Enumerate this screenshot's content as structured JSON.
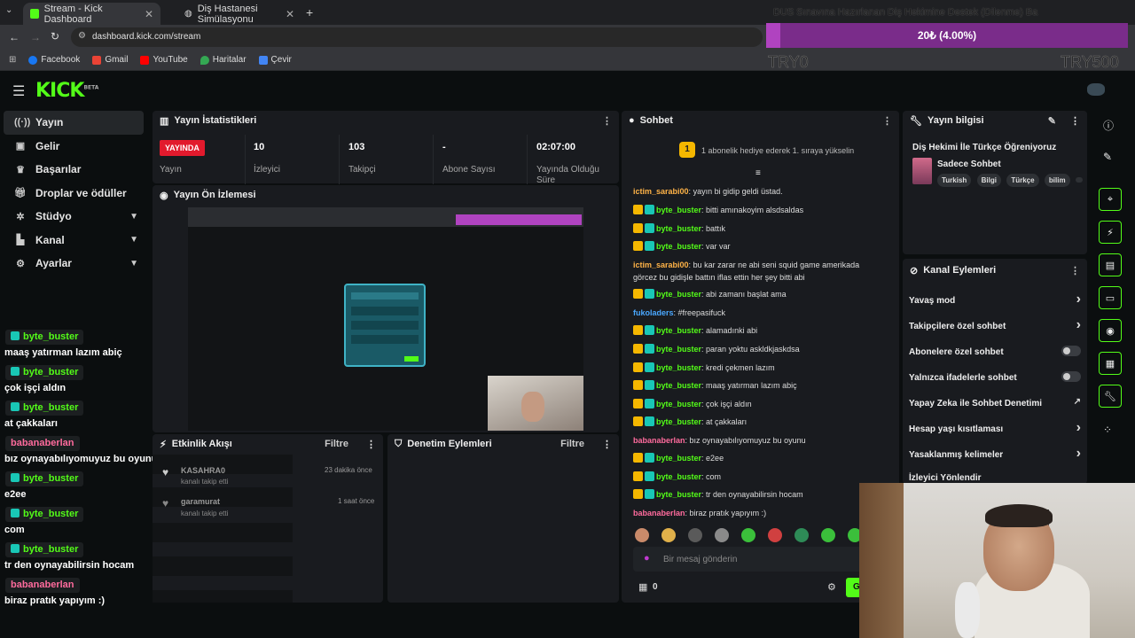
{
  "browser": {
    "tabs": [
      {
        "title": "Stream - Kick Dashboard",
        "active": true
      },
      {
        "title": "Diş Hastanesi Simülasyonu",
        "active": false
      }
    ],
    "url": "dashboard.kick.com/stream",
    "bookmarks": [
      "Facebook",
      "Gmail",
      "YouTube",
      "Haritalar",
      "Çevir"
    ]
  },
  "overlay": {
    "title": "DUS Sınavına Hazırlanan Diş Hekimine Destek (Dilenme) Ba",
    "progress_text": "20₺ (4.00%)",
    "progress_fraction": 0.04,
    "left_label": "TRY0",
    "right_label": "TRY500"
  },
  "kick": {
    "logo": "KICK",
    "logo_sup": "BETA",
    "sidebar": [
      {
        "label": "Yayın",
        "icon": "broadcast-icon",
        "active": true,
        "chevron": false
      },
      {
        "label": "Gelir",
        "icon": "wallet-icon",
        "active": false,
        "chevron": false
      },
      {
        "label": "Başarılar",
        "icon": "trophy-icon",
        "active": false,
        "chevron": false
      },
      {
        "label": "Droplar ve ödüller",
        "icon": "gift-icon",
        "active": false,
        "chevron": false
      },
      {
        "label": "Stüdyo",
        "icon": "studio-icon",
        "active": false,
        "chevron": true
      },
      {
        "label": "Kanal",
        "icon": "channel-icon",
        "active": false,
        "chevron": true
      },
      {
        "label": "Ayarlar",
        "icon": "gear-icon",
        "active": false,
        "chevron": true
      }
    ],
    "stats_panel": {
      "title": "Yayın İstatistikleri",
      "live_badge": "YAYINDA",
      "items": [
        {
          "value": "",
          "label": "Yayın"
        },
        {
          "value": "10",
          "label": "İzleyici"
        },
        {
          "value": "103",
          "label": "Takipçi"
        },
        {
          "value": "-",
          "label": "Abone Sayısı"
        },
        {
          "value": "02:07:00",
          "label": "Yayında Olduğu Süre"
        }
      ]
    },
    "preview_panel": {
      "title": "Yayın Ön İzlemesi"
    },
    "activity_panel": {
      "title": "Etkinlik Akışı",
      "filter": "Filtre",
      "events": [
        {
          "user": "KASAHRA0",
          "action": "kanalı takip etti",
          "time": "23 dakika önce"
        },
        {
          "user": "garamurat",
          "action": "kanalı takip etti",
          "time": "1 saat önce"
        }
      ]
    },
    "moderation_panel": {
      "title": "Denetim Eylemleri",
      "filter": "Filtre"
    },
    "chat_panel": {
      "title": "Sohbet",
      "gift_rank": "1",
      "gift_text": "1 abonelik hediye ederek 1. sıraya yükselin",
      "messages": [
        {
          "user": "ictim_sarabi00",
          "color": "orange",
          "badges": false,
          "text": "yayın bi gidip geldi üstad."
        },
        {
          "user": "byte_buster",
          "color": "green",
          "badges": true,
          "text": "bitti amınakoyim alsdsaldas"
        },
        {
          "user": "byte_buster",
          "color": "green",
          "badges": true,
          "text": "battık"
        },
        {
          "user": "byte_buster",
          "color": "green",
          "badges": true,
          "text": "var var"
        },
        {
          "user": "ictim_sarabi00",
          "color": "orange",
          "badges": false,
          "text": "bu kar zarar ne abi seni squid game amerikada görcez bu gidişle battın iflas ettin her şey bitti abi"
        },
        {
          "user": "byte_buster",
          "color": "green",
          "badges": true,
          "text": "abi zamanı başlat ama"
        },
        {
          "user": "fukoladers",
          "color": "blue",
          "badges": false,
          "text": "#freepasifuck"
        },
        {
          "user": "byte_buster",
          "color": "green",
          "badges": true,
          "text": "alamadınki abi"
        },
        {
          "user": "byte_buster",
          "color": "green",
          "badges": true,
          "text": "paran yoktu askldkjaskdsa"
        },
        {
          "user": "byte_buster",
          "color": "green",
          "badges": true,
          "text": "kredi çekmen lazım"
        },
        {
          "user": "byte_buster",
          "color": "green",
          "badges": true,
          "text": "maaş yatırman lazım abiç"
        },
        {
          "user": "byte_buster",
          "color": "green",
          "badges": true,
          "text": "çok işçi aldın"
        },
        {
          "user": "byte_buster",
          "color": "green",
          "badges": true,
          "text": "at çakkaları"
        },
        {
          "user": "babanaberlan",
          "color": "pink",
          "badges": false,
          "text": "bız oynayabılıyomuyuz bu oyunu"
        },
        {
          "user": "byte_buster",
          "color": "green",
          "badges": true,
          "text": "e2ee"
        },
        {
          "user": "byte_buster",
          "color": "green",
          "badges": true,
          "text": "com"
        },
        {
          "user": "byte_buster",
          "color": "green",
          "badges": true,
          "text": "tr den oynayabilirsin hocam"
        },
        {
          "user": "babanaberlan",
          "color": "pink",
          "badges": false,
          "text": "biraz pratık yapıyım :)"
        }
      ],
      "input_placeholder": "Bir mesaj gönderin",
      "points": "0",
      "send_label": "G"
    },
    "info_panel": {
      "title": "Yayın bilgisi",
      "stream_title": "Diş Hekimi İle Türkçe Öğreniyoruz",
      "category": "Sadece Sohbet",
      "tags": [
        "Turkish",
        "Bilgi",
        "Türkçe",
        "bilim"
      ]
    },
    "channel_actions": {
      "title": "Kanal Eylemleri",
      "items": [
        {
          "label": "Yavaş mod",
          "control": "chevron"
        },
        {
          "label": "Takipçilere özel sohbet",
          "control": "chevron"
        },
        {
          "label": "Abonelere özel sohbet",
          "control": "toggle"
        },
        {
          "label": "Yalnızca ifadelerle sohbet",
          "control": "toggle"
        },
        {
          "label": "Yapay Zeka ile Sohbet Denetimi",
          "control": "external"
        },
        {
          "label": "Hesap yaşı kısıtlaması",
          "control": "chevron"
        },
        {
          "label": "Yasaklanmış kelimeler",
          "control": "chevron"
        },
        {
          "label": "İzleyici Yönlendir",
          "control": "none"
        }
      ]
    }
  },
  "chat_overlay": [
    {
      "user": "byte_buster",
      "color": "green",
      "text": "maaş yatırman lazım abiç"
    },
    {
      "user": "byte_buster",
      "color": "green",
      "text": "çok işçi aldın"
    },
    {
      "user": "byte_buster",
      "color": "green",
      "text": "at çakkaları"
    },
    {
      "user": "babanaberlan",
      "color": "pink",
      "text": "bız oynayabılıyomuyuz bu oyunu"
    },
    {
      "user": "byte_buster",
      "color": "green",
      "text": "e2ee"
    },
    {
      "user": "byte_buster",
      "color": "green",
      "text": "com"
    },
    {
      "user": "byte_buster",
      "color": "green",
      "text": "tr den oynayabilirsin hocam"
    },
    {
      "user": "babanaberlan",
      "color": "pink",
      "text": "biraz pratık yapıyım :)"
    }
  ],
  "colors": {
    "accent": "#53fc18",
    "live": "#e21a2d",
    "overlay_bar": "#b043c0"
  }
}
